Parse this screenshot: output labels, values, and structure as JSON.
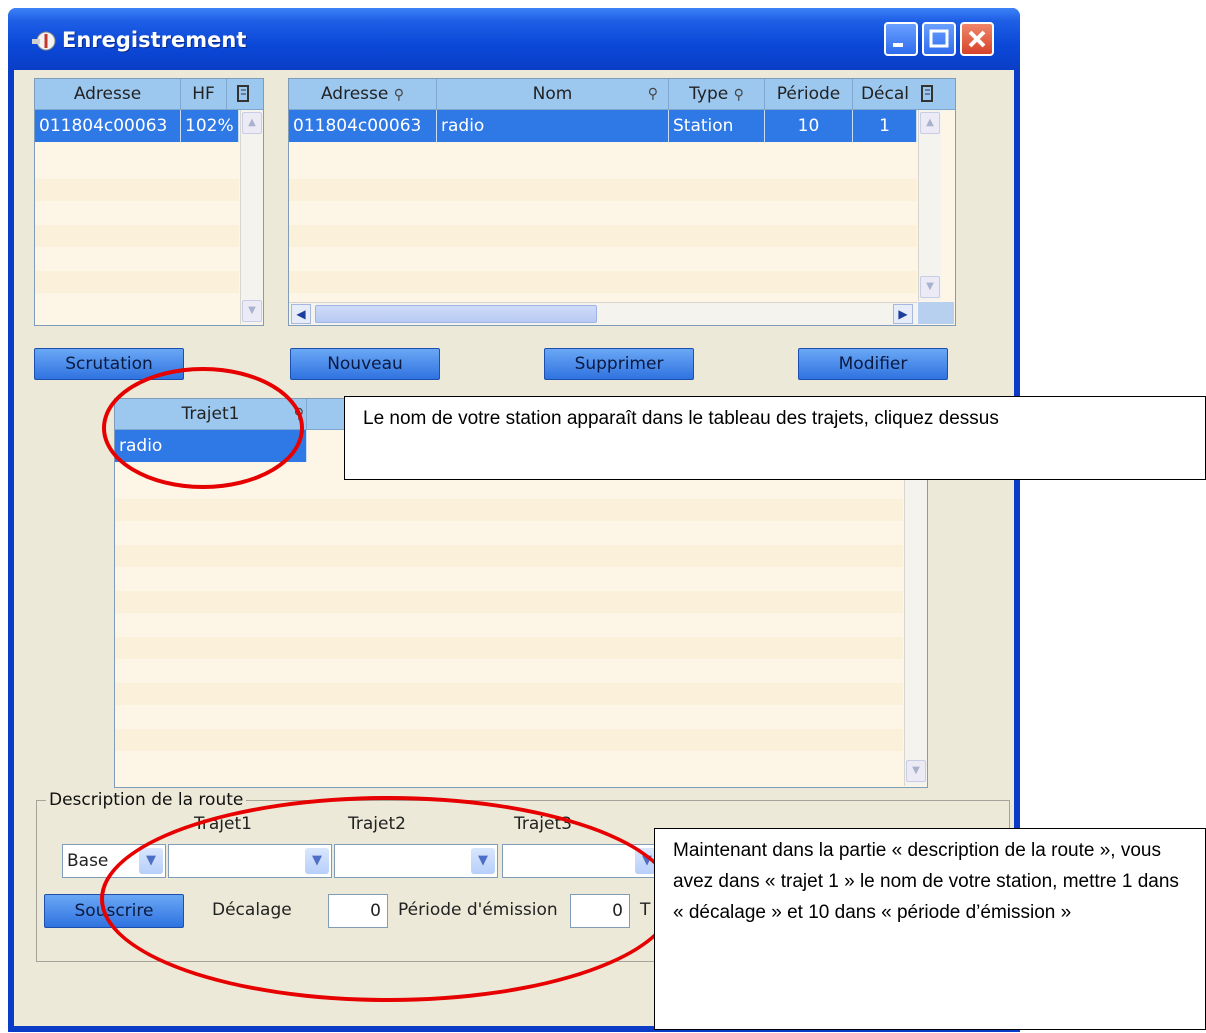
{
  "window": {
    "title": "Enregistrement"
  },
  "left_table": {
    "headers": [
      "Adresse",
      "HF"
    ],
    "rows": [
      [
        "011804c00063",
        "102%"
      ]
    ]
  },
  "right_table": {
    "headers": [
      "Adresse",
      "Nom",
      "Type",
      "Période",
      "Décal"
    ],
    "rows": [
      [
        "011804c00063",
        "radio",
        "Station",
        "10",
        "1"
      ]
    ]
  },
  "buttons": {
    "scrutation": "Scrutation",
    "nouveau": "Nouveau",
    "supprimer": "Supprimer",
    "modifier": "Modifier",
    "souscrire": "Souscrire"
  },
  "trajet_table": {
    "headers": [
      "Trajet1"
    ],
    "rows": [
      [
        "radio"
      ]
    ]
  },
  "route": {
    "group_label": "Description de la route",
    "trajet1_label": "Trajet1",
    "trajet2_label": "Trajet2",
    "trajet3_label": "Trajet3",
    "base_value": "Base",
    "decalage_label": "Décalage",
    "decalage_value": "0",
    "periode_label": "Période d'émission",
    "periode_value": "0",
    "trailing_char": "T"
  },
  "callouts": {
    "top": "Le nom de votre station apparaît dans le tableau des trajets, cliquez dessus",
    "bottom": "Maintenant dans la partie « description de la route », vous avez dans « trajet 1 » le nom de votre station, mettre 1 dans « décalage » et 10 dans « période d’émission »"
  },
  "colors": {
    "title_bar": "#0b48d8",
    "selection": "#2f79e6",
    "annotation": "#e60000"
  },
  "icons": [
    "app-icon",
    "search-icon",
    "column-chooser-icon",
    "chevron-down-icon",
    "arrow-left-icon",
    "arrow-right-icon",
    "arrow-up-icon",
    "arrow-down-icon"
  ]
}
